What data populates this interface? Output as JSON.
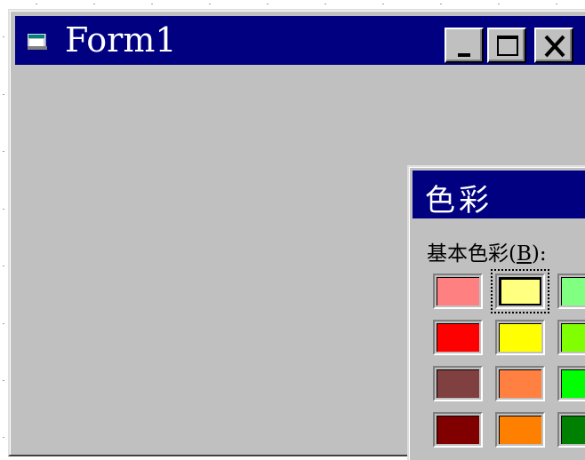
{
  "form": {
    "title": "Form1",
    "icon": "form-window-icon",
    "caption_buttons": [
      "minimize-icon",
      "maximize-icon",
      "close-icon"
    ]
  },
  "color_dialog": {
    "title": "色彩",
    "basic_colors_label_pre": "基本色彩(",
    "basic_colors_hotkey": "B",
    "basic_colors_label_post": "):",
    "selected_swatch": "#ffff80",
    "swatch_rows": [
      [
        "#ff8080",
        "#ffff80",
        "#80ff80"
      ],
      [
        "#ff0000",
        "#ffff00",
        "#80ff00"
      ],
      [
        "#804040",
        "#ff8040",
        "#00ff00"
      ],
      [
        "#800000",
        "#ff8000",
        "#008000"
      ]
    ]
  },
  "colors": {
    "titlebar": "#000080",
    "face": "#c0c0c0",
    "desktop": "#ffffff"
  }
}
